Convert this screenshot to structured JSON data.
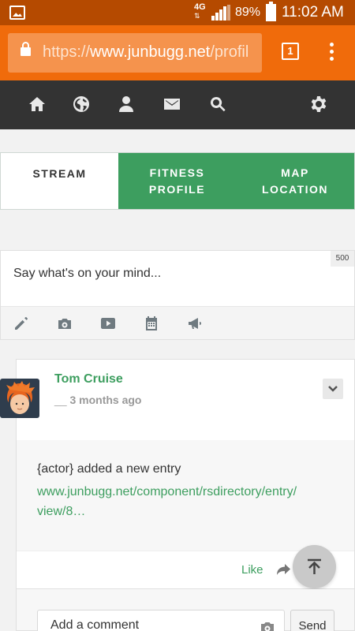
{
  "status_bar": {
    "network": "4G",
    "network_arrows": "⇅",
    "battery_pct": "89%",
    "time": "11:02 AM"
  },
  "browser": {
    "url_prefix": "https://",
    "url_host": "www.junbugg.net",
    "url_rest": "/profil",
    "tab_count": "1"
  },
  "nav": {
    "icons": [
      "home-icon",
      "globe-icon",
      "user-icon",
      "mail-icon",
      "search-icon",
      "gear-icon"
    ]
  },
  "tabs": {
    "stream": "STREAM",
    "fitness_line1": "FITNESS",
    "fitness_line2": "PROFILE",
    "map_line1": "MAP",
    "map_line2": "LOCATION"
  },
  "composer": {
    "char_limit": "500",
    "placeholder": "Say what's on your mind...",
    "tools": [
      "pencil-icon",
      "camera-icon",
      "video-icon",
      "calendar-icon",
      "megaphone-icon"
    ]
  },
  "post": {
    "author": "Tom Cruise",
    "time": "3 months ago",
    "text": "{actor} added a new entry",
    "link_line1": "www.junbugg.net/component/rsdirectory/entry/",
    "link_line2": "view/8…",
    "like_label": "Like"
  },
  "comment": {
    "placeholder": "Add a comment",
    "send_label": "Send"
  },
  "colors": {
    "status_bar": "#b54a00",
    "browser_bar": "#f06b0b",
    "nav_bar": "#333333",
    "accent_green": "#3d9e5f"
  }
}
